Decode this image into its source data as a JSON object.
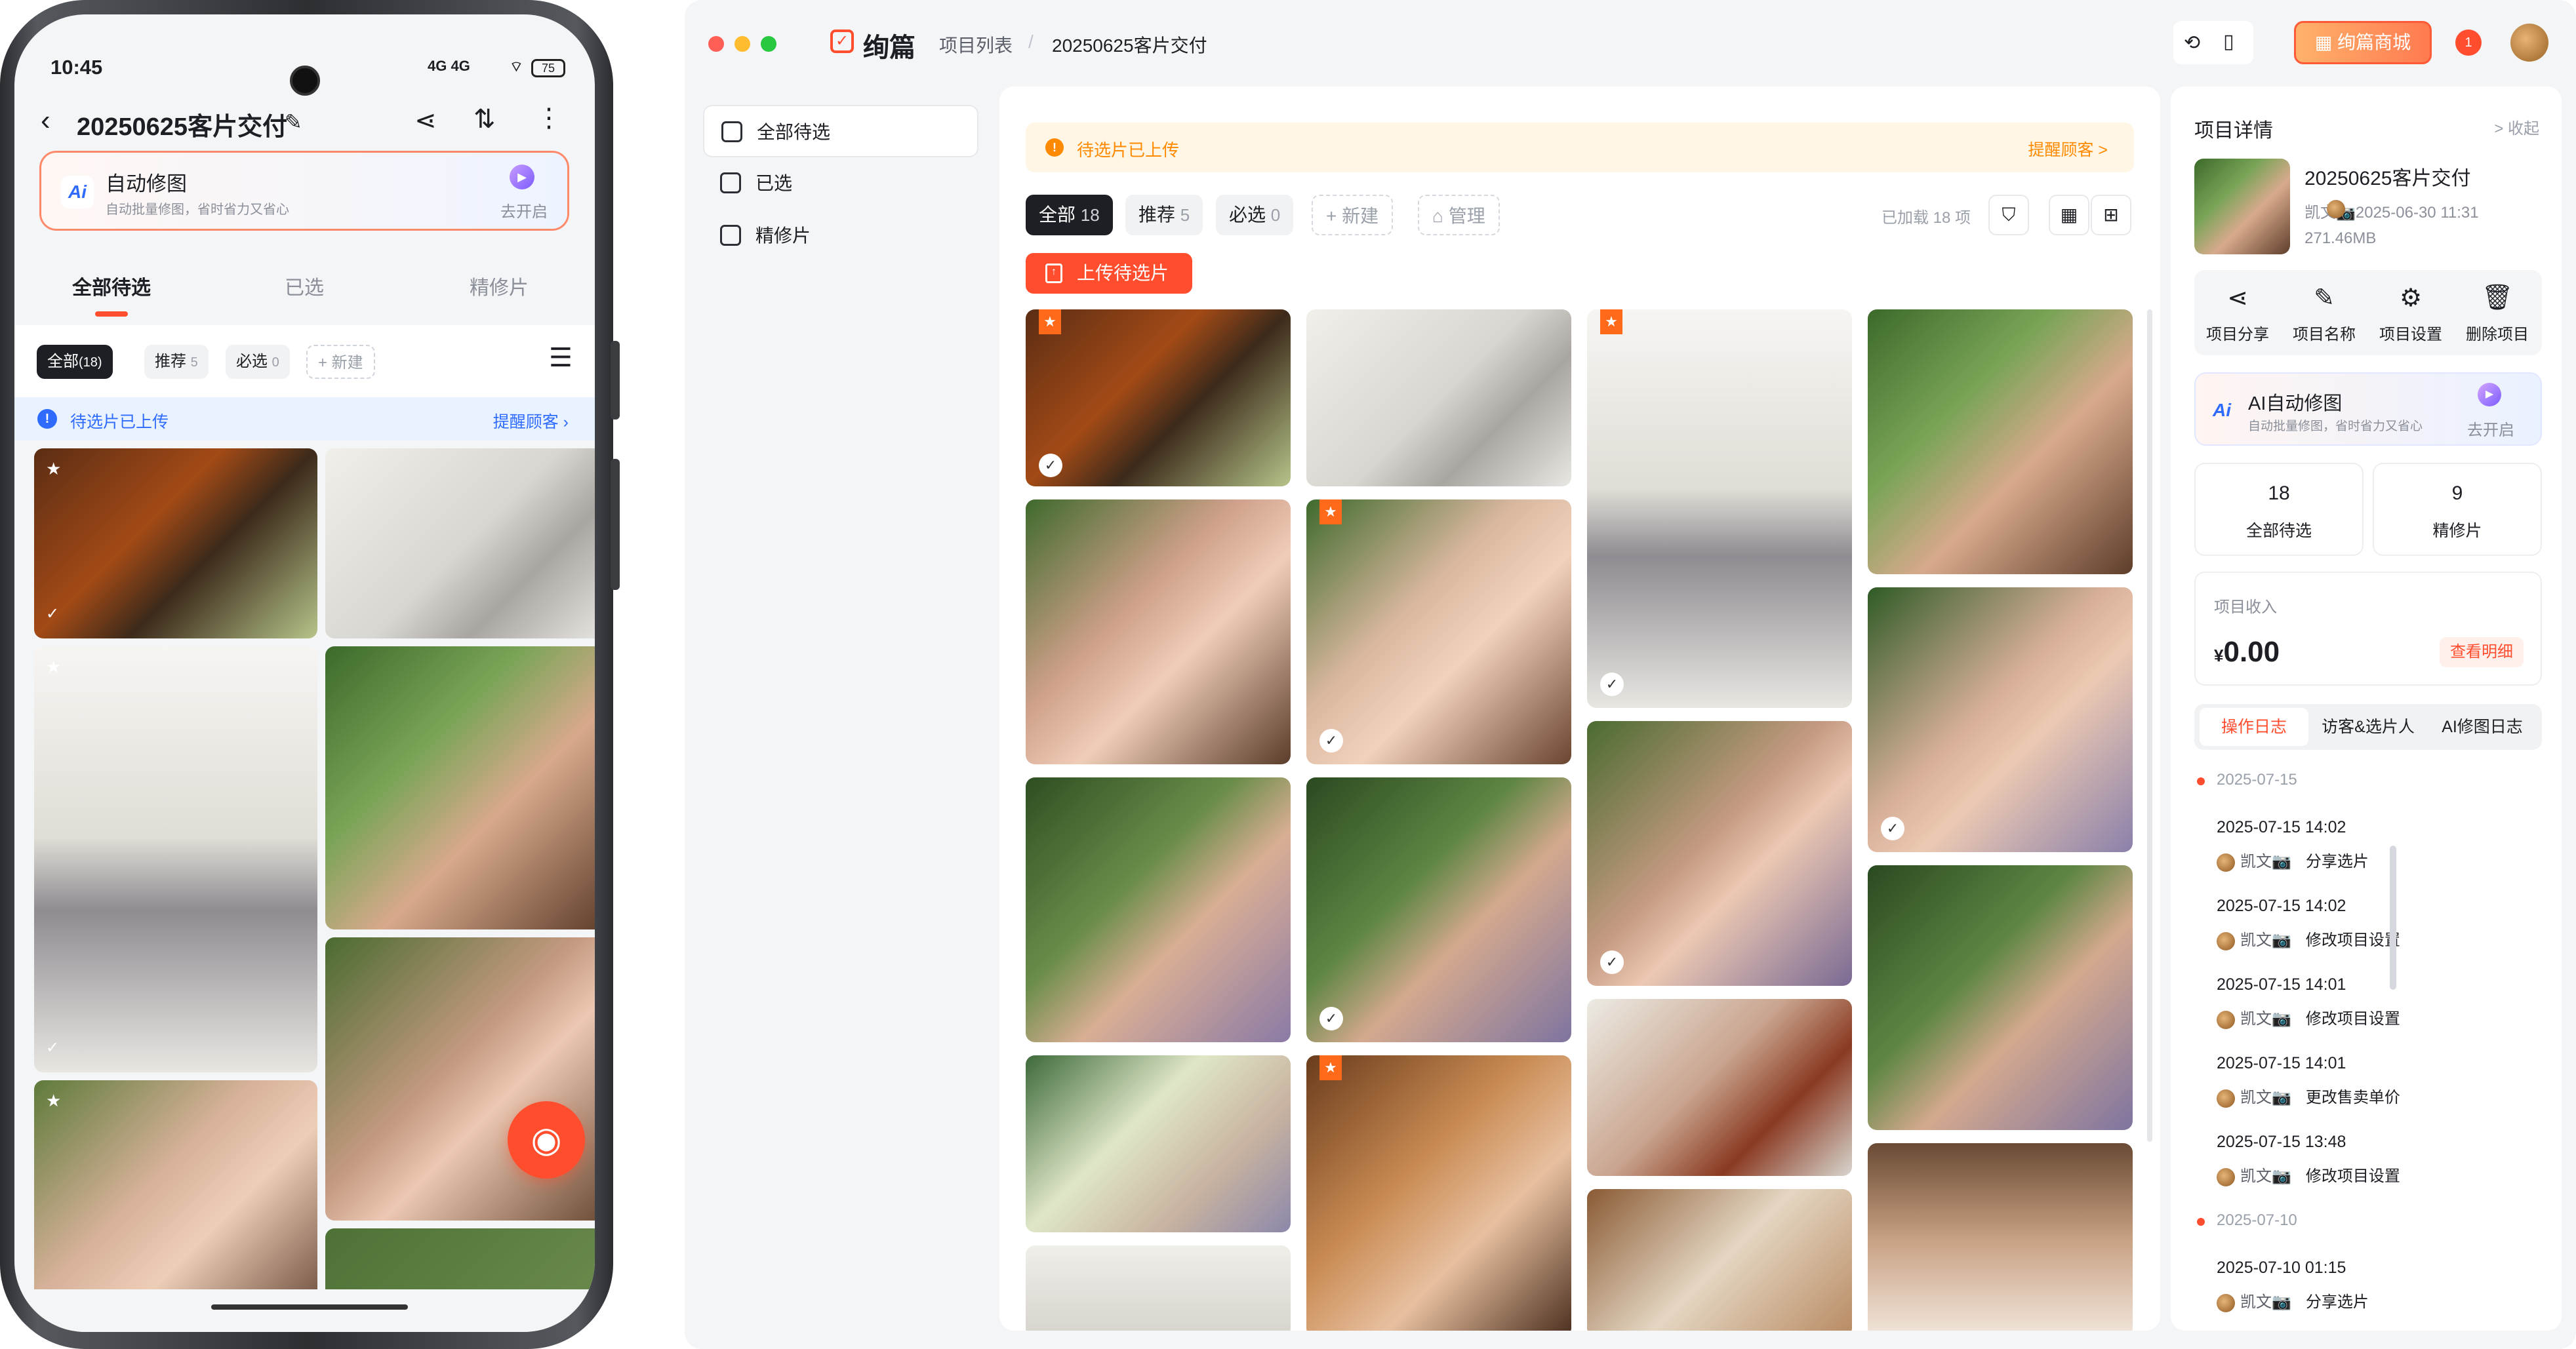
{
  "phone": {
    "status": {
      "time": "10:45",
      "network": "4G 4G",
      "battery": "75"
    },
    "title": "20250625客片交付",
    "ai_card": {
      "title": "自动修图",
      "subtitle": "自动批量修图，省时省力又省心",
      "action": "去开启",
      "logo": "Ai"
    },
    "tabs": [
      "全部待选",
      "已选",
      "精修片"
    ],
    "chips": [
      {
        "label": "全部",
        "count": "(18)"
      },
      {
        "label": "推荐",
        "count": "5"
      },
      {
        "label": "必选",
        "count": "0"
      },
      {
        "label": "+ 新建",
        "count": ""
      }
    ],
    "notice": {
      "text": "待选片已上传",
      "action": "提醒顾客",
      "icon": "info-icon"
    }
  },
  "desktop": {
    "brand": "绚篇",
    "breadcrumb": [
      "项目列表",
      "/",
      "20250625客片交付"
    ],
    "mall_label": "绚篇商城",
    "notif_count": "1",
    "sidebar": [
      {
        "label": "全部待选",
        "icon": "image-icon"
      },
      {
        "label": "已选",
        "icon": "image-check-icon"
      },
      {
        "label": "精修片",
        "icon": "image-star-icon"
      }
    ],
    "notice": {
      "text": "待选片已上传",
      "action": "提醒顾客 >"
    },
    "chips": [
      {
        "label": "全部",
        "count": "18"
      },
      {
        "label": "推荐",
        "count": "5"
      },
      {
        "label": "必选",
        "count": "0"
      },
      {
        "label": "+ 新建",
        "count": ""
      },
      {
        "label": "管理",
        "count": ""
      }
    ],
    "loaded": "已加载 18 项",
    "upload_label": "上传待选片",
    "detail": {
      "heading": "项目详情",
      "collapse": "> 收起",
      "name": "20250625客片交付",
      "user": "凯文📷",
      "date": "2025-06-30 11:31",
      "size": "271.46MB",
      "actions": [
        {
          "label": "项目分享",
          "icon": "share-icon"
        },
        {
          "label": "项目名称",
          "icon": "edit-icon"
        },
        {
          "label": "项目设置",
          "icon": "gear-icon"
        },
        {
          "label": "删除项目",
          "icon": "trash-icon"
        }
      ],
      "ai": {
        "title": "AI自动修图",
        "subtitle": "自动批量修图，省时省力又省心",
        "action": "去开启",
        "logo": "Ai"
      },
      "stats": [
        {
          "value": "18",
          "label": "全部待选"
        },
        {
          "value": "9",
          "label": "精修片"
        }
      ],
      "income": {
        "label": "项目收入",
        "currency": "¥",
        "value": "0.00",
        "button": "查看明细"
      },
      "log_tabs": [
        "操作日志",
        "访客&选片人",
        "AI修图日志"
      ],
      "log_groups": [
        {
          "date": "2025-07-15",
          "entries": [
            {
              "time": "2025-07-15 14:02",
              "user": "凯文📷",
              "action": "分享选片"
            },
            {
              "time": "2025-07-15 14:02",
              "user": "凯文📷",
              "action": "修改项目设置"
            },
            {
              "time": "2025-07-15 14:01",
              "user": "凯文📷",
              "action": "修改项目设置"
            },
            {
              "time": "2025-07-15 14:01",
              "user": "凯文📷",
              "action": "更改售卖单价"
            },
            {
              "time": "2025-07-15 13:48",
              "user": "凯文📷",
              "action": "修改项目设置"
            }
          ]
        },
        {
          "date": "2025-07-10",
          "entries": [
            {
              "time": "2025-07-10 01:15",
              "user": "凯文📷",
              "action": "分享选片"
            }
          ]
        }
      ]
    }
  },
  "colors": {
    "accent": "#ff4d2e",
    "notice_bg": "#fff6e6",
    "notice_fg": "#ff8a00",
    "blue": "#2f6bff"
  }
}
